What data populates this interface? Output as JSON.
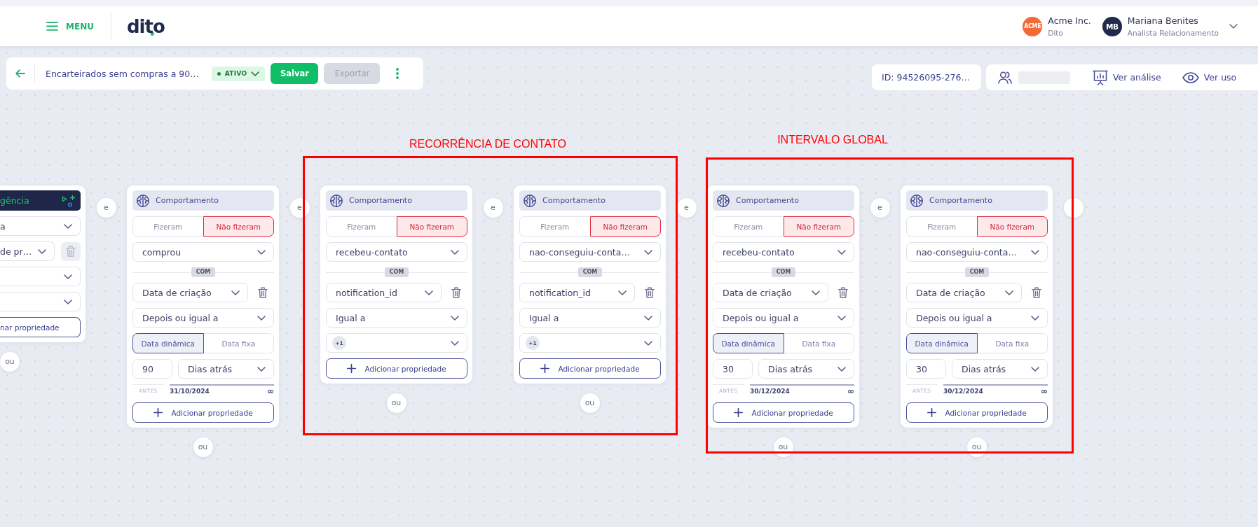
{
  "header": {
    "menu_label": "MENU",
    "logo": "dito",
    "company": {
      "avatar": "ACME",
      "name": "Acme Inc.",
      "subtitle": "Dito"
    },
    "user": {
      "avatar": "MB",
      "name": "Mariana Benites",
      "role": "Analista Relacionamento"
    }
  },
  "toolbar": {
    "title": "Encarteirados sem compras a 90…",
    "status": "ATIVO",
    "buttons": [
      {
        "label": "Salvar",
        "disabled": false
      },
      {
        "label": "Exportar",
        "disabled": true
      }
    ]
  },
  "info_bar": {
    "id": "ID: 94526095-276…",
    "actions": [
      {
        "kind": "analysis",
        "label": "Ver análise"
      },
      {
        "kind": "usage",
        "label": "Ver uso"
      }
    ]
  },
  "partial_card": {
    "title": "gência",
    "and_label": "e",
    "or_label": "ou",
    "rows": [
      {
        "kind": "select",
        "value": "a"
      },
      {
        "kind": "field",
        "value": "de pr…",
        "delete_disabled": true
      },
      {
        "kind": "select"
      },
      {
        "kind": "select"
      },
      {
        "kind": "add",
        "label": "nar propriedade"
      }
    ]
  },
  "cards": [
    {
      "title": "Comportamento",
      "and_label": "e",
      "or_label": "ou",
      "rows": [
        {
          "kind": "did",
          "options": [
            {
              "label": "Fizeram",
              "selected": false
            },
            {
              "label": "Não fizeram",
              "selected": true
            }
          ]
        },
        {
          "kind": "select",
          "value": "comprou"
        },
        {
          "kind": "joiner",
          "label": "COM"
        },
        {
          "kind": "field",
          "value": "Data de criação",
          "delete_disabled": false
        },
        {
          "kind": "select",
          "value": "Depois ou igual a"
        },
        {
          "kind": "mode",
          "options": [
            {
              "label": "Data dinâmica",
              "selected": true
            },
            {
              "label": "Data fixa",
              "selected": false
            }
          ]
        },
        {
          "kind": "amount",
          "amount": "90",
          "unit": "Dias atrás"
        },
        {
          "kind": "range",
          "label": "ANTES",
          "start": "31/10/2024",
          "end": "∞"
        },
        {
          "kind": "add",
          "label": "Adicionar propriedade"
        }
      ]
    },
    {
      "title": "Comportamento",
      "and_label": "e",
      "or_label": "ou",
      "rows": [
        {
          "kind": "did",
          "options": [
            {
              "label": "Fizeram",
              "selected": false
            },
            {
              "label": "Não fizeram",
              "selected": true
            }
          ]
        },
        {
          "kind": "select",
          "value": "recebeu-contato"
        },
        {
          "kind": "joiner",
          "label": "COM"
        },
        {
          "kind": "field",
          "value": "notification_id",
          "delete_disabled": false
        },
        {
          "kind": "select",
          "value": "Igual a"
        },
        {
          "kind": "chips",
          "chips": [
            "+1"
          ]
        },
        {
          "kind": "add",
          "label": "Adicionar propriedade"
        }
      ]
    },
    {
      "title": "Comportamento",
      "and_label": "e",
      "or_label": "ou",
      "rows": [
        {
          "kind": "did",
          "options": [
            {
              "label": "Fizeram",
              "selected": false
            },
            {
              "label": "Não fizeram",
              "selected": true
            }
          ]
        },
        {
          "kind": "select",
          "value": "nao-conseguiu-conta…"
        },
        {
          "kind": "joiner",
          "label": "COM"
        },
        {
          "kind": "field",
          "value": "notification_id",
          "delete_disabled": false
        },
        {
          "kind": "select",
          "value": "Igual a"
        },
        {
          "kind": "chips",
          "chips": [
            "+1"
          ]
        },
        {
          "kind": "add",
          "label": "Adicionar propriedade"
        }
      ]
    },
    {
      "title": "Comportamento",
      "and_label": "e",
      "or_label": "ou",
      "rows": [
        {
          "kind": "did",
          "options": [
            {
              "label": "Fizeram",
              "selected": false
            },
            {
              "label": "Não fizeram",
              "selected": true
            }
          ]
        },
        {
          "kind": "select",
          "value": "recebeu-contato"
        },
        {
          "kind": "joiner",
          "label": "COM"
        },
        {
          "kind": "field",
          "value": "Data de criação",
          "delete_disabled": false
        },
        {
          "kind": "select",
          "value": "Depois ou igual a"
        },
        {
          "kind": "mode",
          "options": [
            {
              "label": "Data dinâmica",
              "selected": true
            },
            {
              "label": "Data fixa",
              "selected": false
            }
          ]
        },
        {
          "kind": "amount",
          "amount": "30",
          "unit": "Dias atrás"
        },
        {
          "kind": "range",
          "label": "ANTES",
          "start": "30/12/2024",
          "end": "∞"
        },
        {
          "kind": "add",
          "label": "Adicionar propriedade"
        }
      ]
    },
    {
      "title": "Comportamento",
      "or_label": "ou",
      "rows": [
        {
          "kind": "did",
          "options": [
            {
              "label": "Fizeram",
              "selected": false
            },
            {
              "label": "Não fizeram",
              "selected": true
            }
          ]
        },
        {
          "kind": "select",
          "value": "nao-conseguiu-conta…"
        },
        {
          "kind": "joiner",
          "label": "COM"
        },
        {
          "kind": "field",
          "value": "Data de criação",
          "delete_disabled": false
        },
        {
          "kind": "select",
          "value": "Depois ou igual a"
        },
        {
          "kind": "mode",
          "options": [
            {
              "label": "Data dinâmica",
              "selected": true
            },
            {
              "label": "Data fixa",
              "selected": false
            }
          ]
        },
        {
          "kind": "amount",
          "amount": "30",
          "unit": "Dias atrás"
        },
        {
          "kind": "range",
          "label": "ANTES",
          "start": "30/12/2024",
          "end": "∞"
        },
        {
          "kind": "add",
          "label": "Adicionar propriedade"
        }
      ]
    }
  ],
  "annotations": [
    {
      "label": "RECORRÊNCIA DE CONTATO"
    },
    {
      "label": "INTERVALO GLOBAL"
    }
  ]
}
